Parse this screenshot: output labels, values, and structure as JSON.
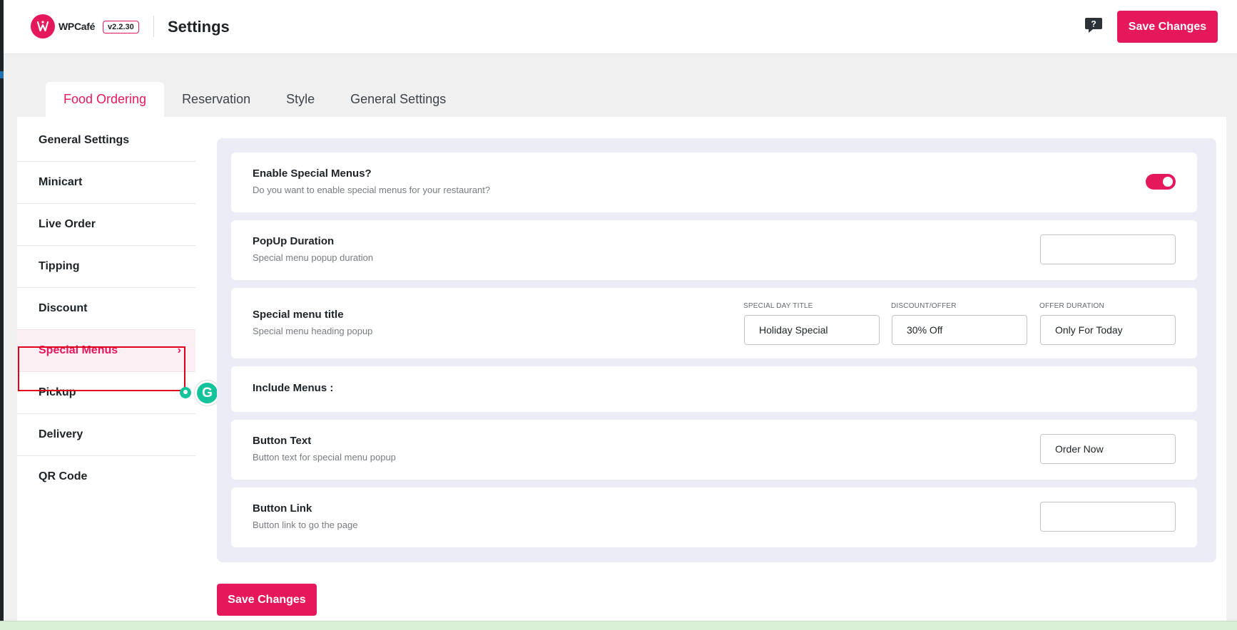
{
  "header": {
    "logo_text": "WPCafé",
    "version": "v2.2.30",
    "title": "Settings",
    "save_label": "Save Changes"
  },
  "tabs": [
    {
      "label": "Food Ordering",
      "active": true
    },
    {
      "label": "Reservation"
    },
    {
      "label": "Style"
    },
    {
      "label": "General Settings"
    }
  ],
  "sidebar": {
    "items": [
      {
        "label": "General Settings"
      },
      {
        "label": "Minicart"
      },
      {
        "label": "Live Order"
      },
      {
        "label": "Tipping"
      },
      {
        "label": "Discount"
      },
      {
        "label": "Special Menus",
        "active": true
      },
      {
        "label": "Pickup"
      },
      {
        "label": "Delivery"
      },
      {
        "label": "QR Code"
      }
    ]
  },
  "settings": {
    "enable_special": {
      "title": "Enable Special Menus?",
      "desc": "Do you want to enable special menus for your restaurant?",
      "enabled": true
    },
    "popup_duration": {
      "title": "PopUp Duration",
      "desc": "Special menu popup duration",
      "value": ""
    },
    "special_title": {
      "title": "Special menu title",
      "desc": "Special menu heading popup",
      "day_label": "SPECIAL DAY TITLE",
      "day_value": "Holiday Special",
      "discount_label": "DISCOUNT/OFFER",
      "discount_value": "30% Off",
      "duration_label": "OFFER DURATION",
      "duration_value": "Only For Today"
    },
    "include_menus": {
      "title": "Include Menus :"
    },
    "button_text": {
      "title": "Button Text",
      "desc": "Button text for special menu popup",
      "value": "Order Now"
    },
    "button_link": {
      "title": "Button Link",
      "desc": "Button link to go the page",
      "value": ""
    }
  },
  "footer": {
    "save_label": "Save Changes"
  },
  "colors": {
    "accent": "#e4185b",
    "panel_bg": "#ebecf5",
    "page_bg": "#f0f0f1"
  }
}
